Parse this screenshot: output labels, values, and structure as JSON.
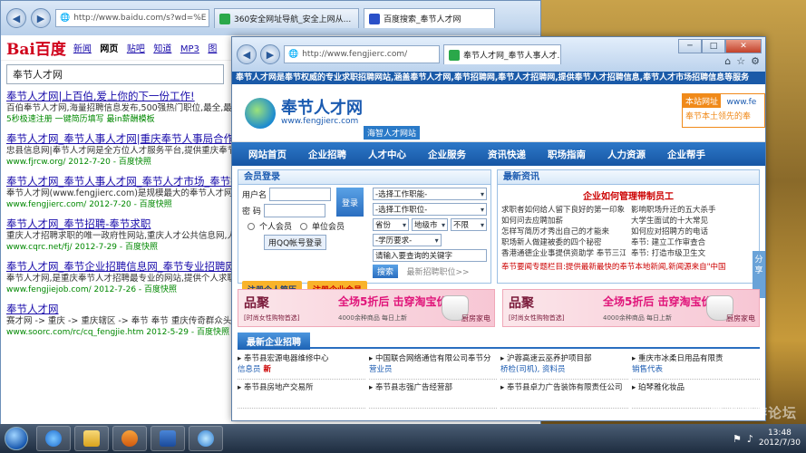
{
  "back_browser": {
    "address": "http://www.baidu.com/s?wd=%E",
    "tabs": [
      {
        "label": "360安全网址导航_安全上网从..."
      },
      {
        "label": "百度搜索_奉节人才网"
      }
    ],
    "logo": "Bai百度",
    "nav": [
      "新闻",
      "网页",
      "贴吧",
      "知道",
      "MP3",
      "图"
    ],
    "search_value": "奉节人才网",
    "results": [
      {
        "title": "奉节人才网|上百伯,爱上你的下一份工作!",
        "desc": "百伯奉节人才网,海量招聘信息发布,500强热门职位,最全,最新",
        "url": "5秒极速注册  一键简历填写  最in薪酬模板"
      },
      {
        "title": "奉节人才网_奉节人事人才网|重庆奉节人事局合作网",
        "desc": "忠县信息网|奉节人才网是全方位人才服务平台,提供重庆奉节求职者和招聘单位提供全面、真实、及时的人才供求信息。促进",
        "url": "www.fjrcw.org/ 2012-7-20 - 百度快照"
      },
      {
        "title": "奉节人才网_奉节人事人才网_奉节人才市场_奉节招聘",
        "desc": "奉节人才网(www.fengjierc.com)是规模最大的奉节人才网和奉节招聘信息,是找奉节人才网招聘首选,将先的奉节招聘网",
        "url": "www.fengjierc.com/ 2012-7-20 - 百度快照"
      },
      {
        "title": "奉节人才网_奉节招聘-奉节求职",
        "desc": "重庆人才招聘求职的唯一政府性网站,重庆人才公共信息网,人才大市场中心,实现全市40个区县和市外20个奉节人才网站",
        "url": "www.cqrc.net/fj/ 2012-7-29 - 百度快照"
      },
      {
        "title": "奉节人才网_奉节企业招聘信息网_奉节专业招聘网",
        "desc": "奉节人才网,是重庆奉节人才招聘最专业的网站,提供个人求职提供人才招聘服务,奉节人才网为不用注册也能发布",
        "url": "www.fengjiejob.com/ 2012-7-26 - 百度快照"
      },
      {
        "title": "奉节人才网",
        "desc": "赛才网 -> 重庆 -> 重庆辖区 -> 奉节 奉节 重庆传奇群众头饮食文化 人事 人才市场 房产 二手房 二手车 中介 微才财经",
        "url": "www.soorc.com/rc/cq_fengjie.htm 2012-5-29 - 百度快照"
      }
    ]
  },
  "front_browser": {
    "address": "http://www.fengjierc.com/",
    "tab_label": "奉节人才网_奉节人事人才...",
    "marquee": "奉节人才网是奉节权威的专业求职招聘网站,涵盖奉节人才网,奉节招聘网,奉节人才招聘网,提供奉节人才招聘信息,奉节人才市场招聘信息等服务",
    "site_name": "奉节人才网",
    "site_url": "www.fengjierc.com",
    "site_sub": "海智人才网站",
    "head_ad": {
      "t1": "本站网址",
      "t2": "www.fe",
      "t3": "奉节本土领先的奉"
    },
    "nav": [
      "网站首页",
      "企业招聘",
      "人才中心",
      "企业服务",
      "资讯快递",
      "职场指南",
      "人力资源",
      "企业帮手"
    ],
    "login": {
      "title": "会员登录",
      "username_label": "用户名",
      "password_label": "密 码",
      "login_button": "登录",
      "personal_radio": "个人会员",
      "company_radio": "单位会员",
      "qq_button": "用QQ帐号登录",
      "job_category": "-选择工作职能-",
      "job_position": "-选择工作职位-",
      "province": "省份",
      "city": "地级市",
      "district": "不限",
      "education": "-学历要求-",
      "keyword": "请输入要查询的关键字",
      "search_button": "搜索",
      "advanced": "最新招聘职位>>",
      "register_person": "注册个人简历",
      "register_company": "注册企业会员"
    },
    "news": {
      "title": "最新资讯",
      "headline": "企业如何管理带制员工",
      "items": [
        "求职者如何给人留下良好的第一印象",
        "影响职场升迁的五大杀手",
        "如何问去应聘加薪",
        "大学生面试的十大常见",
        "怎样写简历才秀出自己的才能来",
        "如何应对招聘方的电话",
        "职场新人做建被委的四个秘密",
        "奉节: 建立工作审查合",
        "香港通德企业事提供资助学 奉节三江小学",
        "奉节: 打造市级卫生文"
      ],
      "ticker": "奉节要闻专题栏目:提供最新最快的奉节本地新闻,新闻源来自\"中国"
    },
    "side_tab": "分享",
    "banners": [
      {
        "brand": "品聚",
        "sub": "[时尚女性购物首选]",
        "main": "全场5折后 击穿淘宝价",
        "tag": "4000余种商品 每日上新",
        "cat": "厨房家电"
      },
      {
        "brand": "品聚",
        "sub": "[时尚女性购物首选]",
        "main": "全场5折后 击穿淘宝价",
        "tag": "4000余种商品 每日上新",
        "cat": "厨房家电"
      }
    ],
    "enterprise_title": "最新企业招聘",
    "enterprises": [
      {
        "name": "奉节县宏源电器维修中心",
        "job": "信息员",
        "badge": "新"
      },
      {
        "name": "中国联合网络通信有限公司奉节分",
        "job": "营业员",
        "badge": ""
      },
      {
        "name": "沪蓉高速云巫养护项目部",
        "job": "桥检(司机), 资料员",
        "badge": ""
      },
      {
        "name": "重庆市冰柔日用品有限责",
        "job": "销售代表",
        "badge": ""
      },
      {
        "name": "奉节县房地产交易所",
        "job": "",
        "badge": ""
      },
      {
        "name": "奉节县志强广告经营部",
        "job": "",
        "badge": ""
      },
      {
        "name": "奉节县卓力广告装饰有限责任公司",
        "job": "",
        "badge": ""
      },
      {
        "name": "珀琴雅化妆品",
        "job": "",
        "badge": ""
      }
    ]
  },
  "taskbar": {
    "time": "13:48",
    "date": "2012/7/30"
  },
  "watermark": "鸿成旅游论坛"
}
